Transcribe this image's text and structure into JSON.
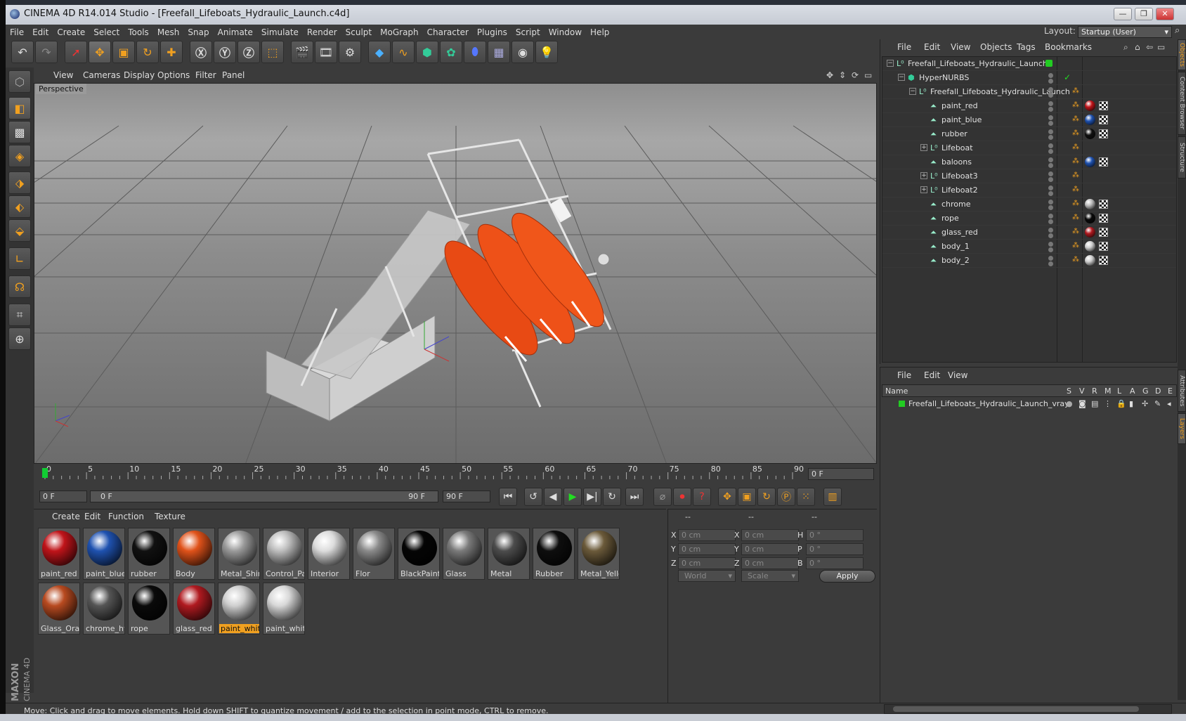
{
  "window": {
    "title": "CINEMA 4D R14.014 Studio - [Freefall_Lifeboats_Hydraulic_Launch.c4d]"
  },
  "menubar": [
    "File",
    "Edit",
    "Create",
    "Select",
    "Tools",
    "Mesh",
    "Snap",
    "Animate",
    "Simulate",
    "Render",
    "Sculpt",
    "MoGraph",
    "Character",
    "Plugins",
    "Script",
    "Window",
    "Help"
  ],
  "layout": {
    "label": "Layout:",
    "value": "Startup (User)"
  },
  "viewport": {
    "menu": [
      "View",
      "Cameras",
      "Display",
      "Options",
      "Filter",
      "Panel"
    ],
    "label": "Perspective"
  },
  "timeline": {
    "ticks": [
      "0",
      "5",
      "10",
      "15",
      "20",
      "25",
      "30",
      "35",
      "40",
      "45",
      "50",
      "55",
      "60",
      "65",
      "70",
      "75",
      "80",
      "85",
      "90"
    ],
    "current_frame": "0 F"
  },
  "transport": {
    "start_field": "0 F",
    "range_start": "0 F",
    "range_end": "90 F",
    "end_field": "90 F"
  },
  "materials": {
    "menu": [
      "Create",
      "Edit",
      "Function",
      "Texture"
    ],
    "items": [
      {
        "name": "paint_red",
        "color": "#c0141a"
      },
      {
        "name": "paint_blue",
        "color": "#1f52b0"
      },
      {
        "name": "rubber",
        "color": "#111111"
      },
      {
        "name": "Body",
        "color": "#e0521a"
      },
      {
        "name": "Metal_Shin",
        "color": "#9a9a9a"
      },
      {
        "name": "Control_Pa",
        "color": "#bdbdbd"
      },
      {
        "name": "Interior",
        "color": "#dcdcdc"
      },
      {
        "name": "Flor",
        "color": "#8a8a8a"
      },
      {
        "name": "BlackPaint",
        "color": "#050505"
      },
      {
        "name": "Glass",
        "color": "#7a7a7a"
      },
      {
        "name": "Metal",
        "color": "#4c4c4c"
      },
      {
        "name": "Rubber",
        "color": "#0e0e0e"
      },
      {
        "name": "Metal_Yello",
        "color": "#6b5a3a"
      },
      {
        "name": "Glass_Oran",
        "color": "#b84a20"
      },
      {
        "name": "chrome_hy",
        "color": "#555555"
      },
      {
        "name": "rope",
        "color": "#0a0a0a"
      },
      {
        "name": "glass_red",
        "color": "#b01a20"
      },
      {
        "name": "paint_whit",
        "color": "#cfcfcf",
        "selected": true
      },
      {
        "name": "paint_whit",
        "color": "#d8d8d8"
      }
    ]
  },
  "coords": {
    "header": [
      "--",
      "--",
      "--"
    ],
    "rows": [
      {
        "a": "X",
        "av": "0 cm",
        "b": "X",
        "bv": "0 cm",
        "c": "H",
        "cv": "0 °"
      },
      {
        "a": "Y",
        "av": "0 cm",
        "b": "Y",
        "bv": "0 cm",
        "c": "P",
        "cv": "0 °"
      },
      {
        "a": "Z",
        "av": "0 cm",
        "b": "Z",
        "bv": "0 cm",
        "c": "B",
        "cv": "0 °"
      }
    ],
    "world": "World",
    "scale": "Scale",
    "apply": "Apply"
  },
  "objects": {
    "menu": [
      "File",
      "Edit",
      "View",
      "Objects",
      "Tags",
      "Bookmarks"
    ],
    "rows": [
      {
        "name": "Freefall_Lifeboats_Hydraulic_Launch",
        "indent": 0,
        "expander": "−",
        "icon": "null",
        "tags": []
      },
      {
        "name": "HyperNURBS",
        "indent": 1,
        "expander": "−",
        "icon": "nurbs",
        "tags": []
      },
      {
        "name": "Freefall_Lifeboats_Hydraulic_Launch",
        "indent": 2,
        "expander": "−",
        "icon": "null",
        "tags": []
      },
      {
        "name": "paint_red",
        "indent": 3,
        "icon": "poly",
        "tags": [
          "#c0141a"
        ]
      },
      {
        "name": "paint_blue",
        "indent": 3,
        "icon": "poly",
        "tags": [
          "#1f52b0"
        ]
      },
      {
        "name": "rubber",
        "indent": 3,
        "icon": "poly",
        "tags": [
          "#111111"
        ]
      },
      {
        "name": "Lifeboat",
        "indent": 3,
        "expander": "+",
        "icon": "null",
        "tags": []
      },
      {
        "name": "baloons",
        "indent": 3,
        "icon": "poly",
        "tags": [
          "#1f52b0"
        ]
      },
      {
        "name": "Lifeboat3",
        "indent": 3,
        "expander": "+",
        "icon": "null",
        "tags": []
      },
      {
        "name": "Lifeboat2",
        "indent": 3,
        "expander": "+",
        "icon": "null",
        "tags": []
      },
      {
        "name": "chrome",
        "indent": 3,
        "icon": "poly",
        "tags": [
          "#bbbbbb"
        ]
      },
      {
        "name": "rope",
        "indent": 3,
        "icon": "poly",
        "tags": [
          "#0a0a0a"
        ]
      },
      {
        "name": "glass_red",
        "indent": 3,
        "icon": "poly",
        "tags": [
          "#b01a20"
        ]
      },
      {
        "name": "body_1",
        "indent": 3,
        "icon": "poly",
        "tags": [
          "#cfcfcf"
        ]
      },
      {
        "name": "body_2",
        "indent": 3,
        "icon": "poly",
        "tags": [
          "#cfcfcf"
        ]
      }
    ]
  },
  "layers": {
    "menu": [
      "File",
      "Edit",
      "View"
    ],
    "columns": [
      "Name",
      "S",
      "V",
      "R",
      "M",
      "L",
      "A",
      "G",
      "D",
      "E"
    ],
    "row": "Freefall_Lifeboats_Hydraulic_Launch_vray"
  },
  "side_tabs": [
    "Objects",
    "Content Browser",
    "Structure",
    "Attributes",
    "Layers"
  ],
  "status": "Move: Click and drag to move elements. Hold down SHIFT to quantize movement / add to the selection in point mode, CTRL to remove.",
  "brand": {
    "maxon": "MAXON",
    "product": "CINEMA 4D"
  }
}
